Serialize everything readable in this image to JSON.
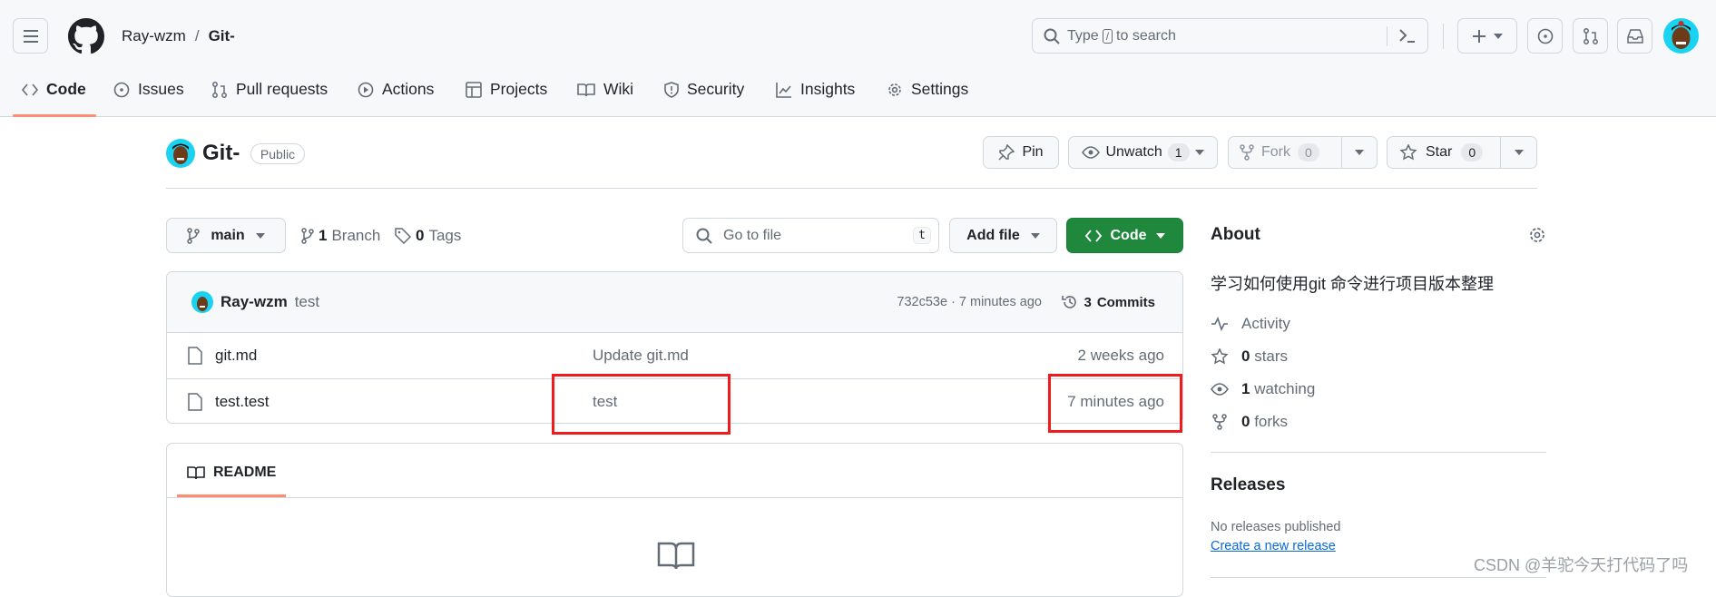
{
  "header": {
    "owner": "Ray-wzm",
    "separator": "/",
    "repo": "Git-",
    "search_placeholder_pre": "Type",
    "search_key": "/",
    "search_placeholder_post": "to search"
  },
  "tabs": [
    {
      "label": "Code",
      "icon": "code-icon"
    },
    {
      "label": "Issues",
      "icon": "issue-icon"
    },
    {
      "label": "Pull requests",
      "icon": "pull-request-icon"
    },
    {
      "label": "Actions",
      "icon": "play-icon"
    },
    {
      "label": "Projects",
      "icon": "table-icon"
    },
    {
      "label": "Wiki",
      "icon": "book-icon"
    },
    {
      "label": "Security",
      "icon": "shield-icon"
    },
    {
      "label": "Insights",
      "icon": "graph-icon"
    },
    {
      "label": "Settings",
      "icon": "gear-icon"
    }
  ],
  "repo": {
    "name": "Git-",
    "visibility": "Public",
    "pin": "Pin",
    "unwatch": "Unwatch",
    "watch_count": "1",
    "fork": "Fork",
    "fork_count": "0",
    "star": "Star",
    "star_count": "0"
  },
  "toolbar": {
    "branch": "main",
    "branches_count": "1",
    "branches_label": "Branch",
    "tags_count": "0",
    "tags_label": "Tags",
    "goto_placeholder": "Go to file",
    "goto_key": "t",
    "add_file": "Add file",
    "code": "Code"
  },
  "commit": {
    "author": "Ray-wzm",
    "message": "test",
    "hash": "732c53e",
    "time": "7 minutes ago",
    "commits_count": "3",
    "commits_label": "Commits"
  },
  "files": [
    {
      "name": "git.md",
      "message": "Update git.md",
      "time": "2 weeks ago"
    },
    {
      "name": "test.test",
      "message": "test",
      "time": "7 minutes ago"
    }
  ],
  "readme": {
    "tab": "README"
  },
  "about": {
    "title": "About",
    "description": "学习如何使用git 命令进行项目版本整理",
    "activity": "Activity",
    "stars_count": "0",
    "stars_label": "stars",
    "watching_count": "1",
    "watching_label": "watching",
    "forks_count": "0",
    "forks_label": "forks"
  },
  "releases": {
    "title": "Releases",
    "empty": "No releases published",
    "create": "Create a new release"
  },
  "watermark": "CSDN @羊驼今天打代码了吗",
  "colors": {
    "accent_underline": "#fd8c73",
    "primary_green": "#1f883d",
    "link": "#0969da",
    "highlight_box": "#f01c1c"
  }
}
